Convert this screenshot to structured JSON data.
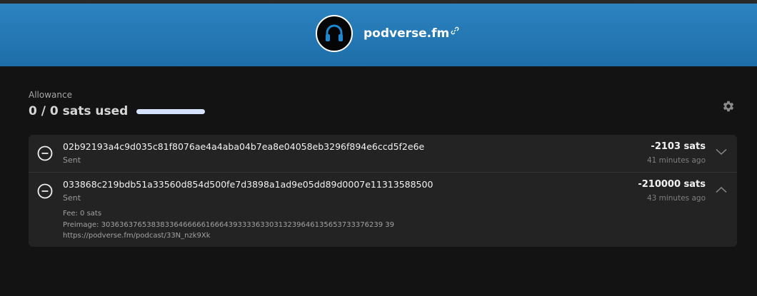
{
  "header": {
    "site_name": "podverse.fm",
    "avatar_icon": "headphones-icon",
    "link_icon": "link-icon",
    "background_color": "#2479b5"
  },
  "allowance": {
    "label": "Allowance",
    "usage_text": "0 / 0 sats used",
    "progress_fraction": 0,
    "settings_icon": "gear-icon"
  },
  "transactions": [
    {
      "id": "02b92193a4c9d035c81f8076ae4a4aba04b7ea8e04058eb3296f894e6ccd5f2e6e",
      "status": "Sent",
      "amount": "-2103 sats",
      "time": "41 minutes ago",
      "expanded": false
    },
    {
      "id": "033868c219bdb51a33560d854d500fe7d3898a1ad9e05dd89d0007e11313588500",
      "status": "Sent",
      "amount": "-210000 sats",
      "time": "43 minutes ago",
      "expanded": true,
      "fee": "Fee: 0 sats",
      "preimage": "Preimage: 30363637653838336466666166643933336330313239646135653733376239 39",
      "url": "https://podverse.fm/podcast/33N_nzk9Xk"
    }
  ]
}
